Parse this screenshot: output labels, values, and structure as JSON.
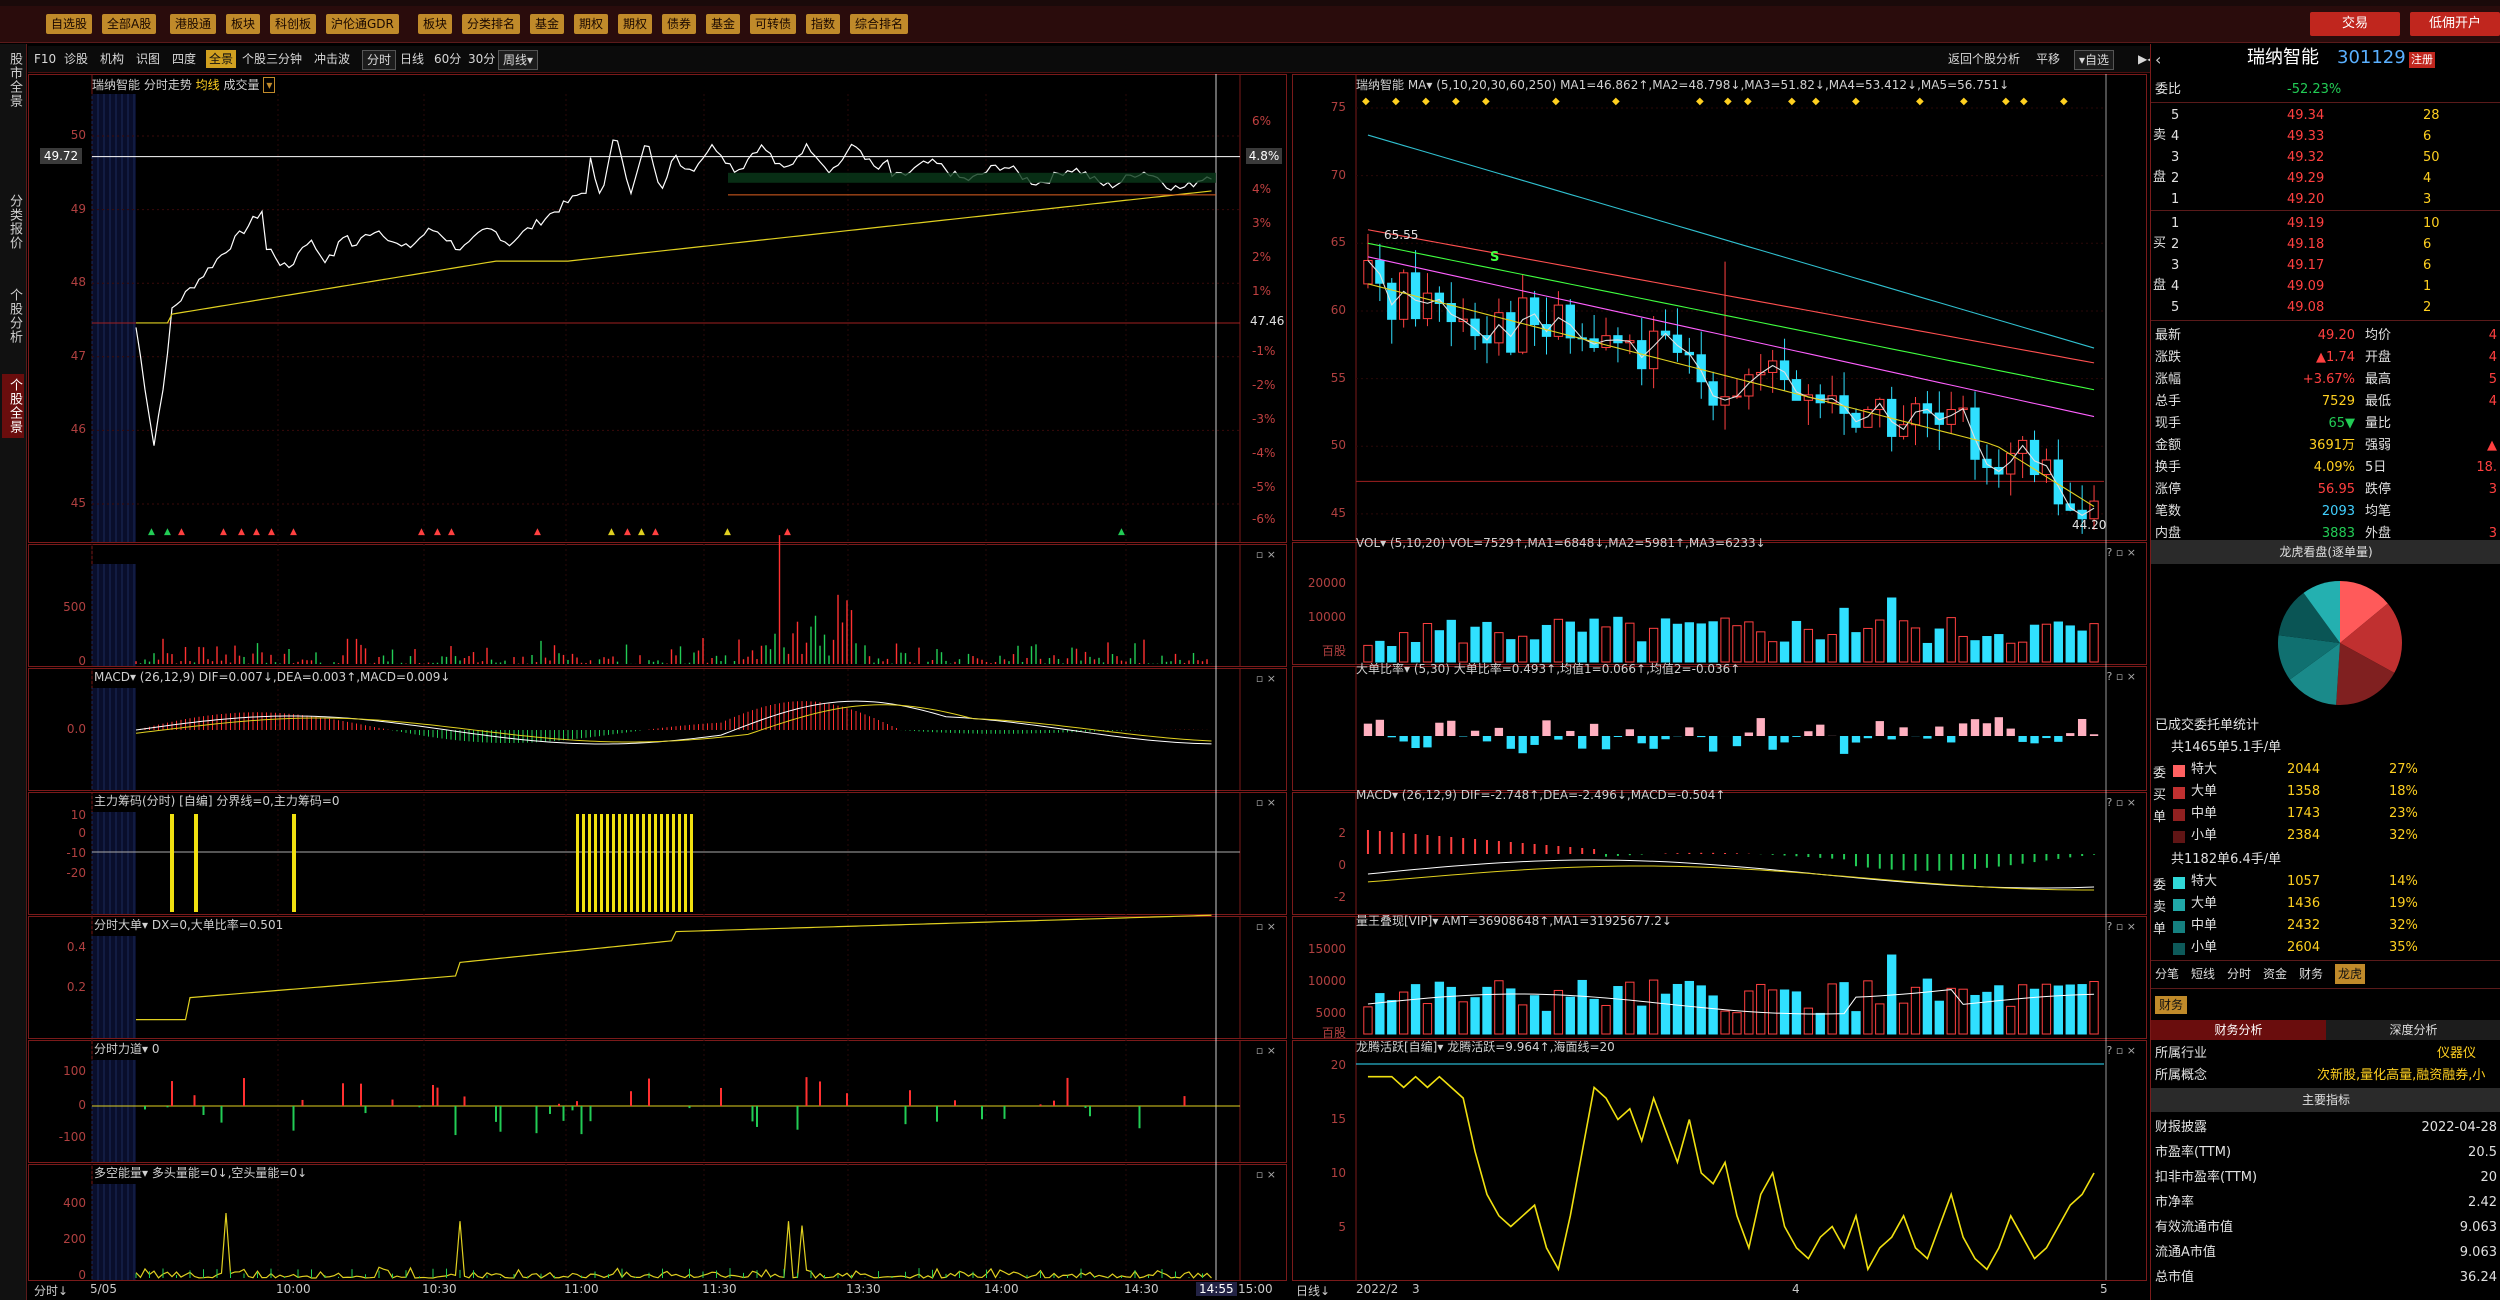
{
  "toolbar": {
    "buttons": [
      "自选股",
      "全部A股",
      "港股通",
      "板块",
      "科创板",
      "沪伦通GDR",
      "板块",
      "分类排名",
      "基金",
      "期权",
      "期权",
      "债券",
      "基金",
      "可转债",
      "指数",
      "综合排名"
    ],
    "right_buttons": [
      "交易",
      "低佣开户"
    ]
  },
  "leftnav": {
    "tabs": [
      "股市全景",
      "分类报价",
      "个股分析",
      "个股全景"
    ]
  },
  "subbar": {
    "items": [
      "F10",
      "诊股",
      "机构",
      "识图",
      "四度",
      "全景",
      "个股三分钟",
      "冲击波",
      "分时",
      "日线",
      "60分",
      "30分",
      "周线▾"
    ],
    "right_items": [
      "返回个股分析",
      "平移",
      "▾自选"
    ]
  },
  "intraday": {
    "title": "瑞纳智能  分时走势",
    "title_avg": "均线",
    "title_vol": "成交量",
    "price_ticks": [
      "50",
      "49",
      "48",
      "47",
      "46",
      "45"
    ],
    "pct_ticks": [
      "6%",
      "5%",
      "4%",
      "3%",
      "2%",
      "1%",
      "-1%",
      "-2%",
      "-3%",
      "-4%",
      "-5%",
      "-6%"
    ],
    "cursor_price": "49.72",
    "cursor_pct": "4.8%",
    "ref_price": "47.46",
    "vol_ticks": [
      "500",
      "0"
    ],
    "time_ticks": [
      "5/05",
      "10:00",
      "10:30",
      "11:00",
      "11:30",
      "13:30",
      "14:00",
      "14:30"
    ],
    "time_cursor": "14:55",
    "time_end": "15:00",
    "corner_label": "分时",
    "macd_title": "MACD▾ (26,12,9) DIF=0.007↓,DEA=0.003↑,MACD=0.009↓",
    "macd_ticks": [
      "0.0"
    ],
    "zl_title": "主力筹码(分时) [自编]  分界线=0,主力筹码=0",
    "zl_ticks": [
      "10",
      "0",
      "-10",
      "-20"
    ],
    "dd_title": "分时大单▾  DX=0,大单比率=0.501",
    "dd_ticks": [
      "0.4",
      "0.2"
    ],
    "ld_title": "分时力道▾  0",
    "ld_ticks": [
      "100",
      "0",
      "-100"
    ],
    "dk_title": "多空能量▾  多头量能=0↓,空头量能=0↓",
    "dk_ticks": [
      "400",
      "200",
      "0"
    ]
  },
  "kline": {
    "title": "瑞纳智能   MA▾ (5,10,20,30,60,250)  MA1=46.862↑,MA2=48.798↓,MA3=51.82↓,MA4=53.412↓,MA5=56.751↓",
    "price_ticks": [
      "75",
      "70",
      "65",
      "60",
      "55",
      "50",
      "45"
    ],
    "high_label": "65.55",
    "low_label": "44.20",
    "s_label": "S",
    "vol_title": "VOL▾ (5,10,20) VOL=7529↑,MA1=6848↓,MA2=5981↑,MA3=6233↓",
    "vol_ticks": [
      "20000",
      "10000",
      "百股"
    ],
    "ddb_title": "大单比率▾ (5,30) 大单比率=0.493↑,均值1=0.066↑,均值2=-0.036↑",
    "macd_title": "MACD▾ (26,12,9) DIF=-2.748↑,DEA=-2.496↓,MACD=-0.504↑",
    "macd_ticks": [
      "2",
      "0",
      "-2"
    ],
    "lz_title": "量王叠现[VIP]▾  AMT=36908648↑,MA1=31925677.2↓",
    "lz_ticks": [
      "15000",
      "10000",
      "5000",
      "百股"
    ],
    "lt_title": "龙腾活跃[自编]▾  龙腾活跃=9.964↑,海面线=20",
    "lt_ticks": [
      "20",
      "15",
      "10",
      "5"
    ],
    "date_ticks": [
      "2022/2",
      "3",
      "4",
      "5"
    ],
    "corner_label": "日线"
  },
  "sidebar": {
    "stock_name": "瑞纳智能",
    "stock_code": "301129",
    "badge": "注册",
    "webi_label": "委比",
    "webi_value": "-52.23%",
    "asks": [
      {
        "lv": "5",
        "price": "49.34",
        "vol": "28"
      },
      {
        "lv": "4",
        "price": "49.33",
        "vol": "6"
      },
      {
        "lv": "3",
        "price": "49.32",
        "vol": "50"
      },
      {
        "lv": "2",
        "price": "49.29",
        "vol": "4"
      },
      {
        "lv": "1",
        "price": "49.20",
        "vol": "3"
      }
    ],
    "bids": [
      {
        "lv": "1",
        "price": "49.19",
        "vol": "10"
      },
      {
        "lv": "2",
        "price": "49.18",
        "vol": "6"
      },
      {
        "lv": "3",
        "price": "49.17",
        "vol": "6"
      },
      {
        "lv": "4",
        "price": "49.09",
        "vol": "1"
      },
      {
        "lv": "5",
        "price": "49.08",
        "vol": "2"
      }
    ],
    "ask_side_label": [
      "卖",
      "盘"
    ],
    "bid_side_label": [
      "买",
      "盘"
    ],
    "quote": [
      {
        "l": "最新",
        "v": "49.20",
        "l2": "均价",
        "v2": "4"
      },
      {
        "l": "涨跌",
        "v": "▲1.74",
        "l2": "开盘",
        "v2": "4"
      },
      {
        "l": "涨幅",
        "v": "+3.67%",
        "l2": "最高",
        "v2": "5"
      },
      {
        "l": "总手",
        "v": "7529",
        "l2": "最低",
        "v2": "4"
      },
      {
        "l": "现手",
        "v": "65▼",
        "l2": "量比",
        "v2": ""
      },
      {
        "l": "金额",
        "v": "3691万",
        "l2": "强弱",
        "v2": "▲"
      },
      {
        "l": "换手",
        "v": "4.09%",
        "l2": "5日",
        "v2": "18."
      },
      {
        "l": "涨停",
        "v": "56.95",
        "l2": "跌停",
        "v2": "3"
      },
      {
        "l": "笔数",
        "v": "2093",
        "l2": "均笔",
        "v2": ""
      },
      {
        "l": "内盘",
        "v": "3883",
        "l2": "外盘",
        "v2": "3"
      }
    ],
    "pie_title": "龙虎看盘(逐单量)",
    "pie_slices": [
      {
        "value": 14,
        "color": "#ff5a5a"
      },
      {
        "value": 19,
        "color": "#c03030"
      },
      {
        "value": 18,
        "color": "#802020"
      },
      {
        "value": 14,
        "color": "#1a8a8a"
      },
      {
        "value": 12,
        "color": "#107070"
      },
      {
        "value": 13,
        "color": "#0a5555"
      },
      {
        "value": 10,
        "color": "#24b0b0"
      }
    ],
    "stats_title": "已成交委托单统计",
    "buy_group": "共1465单5.1手/单",
    "sell_group": "共1182单6.4手/单",
    "buy_side_label": [
      "委",
      "买",
      "单"
    ],
    "sell_side_label": [
      "委",
      "卖",
      "单"
    ],
    "buy_rows": [
      {
        "name": "特大",
        "vol": "2044",
        "pct": "27%",
        "color": "#ff6060"
      },
      {
        "name": "大单",
        "vol": "1358",
        "pct": "18%",
        "color": "#c03030"
      },
      {
        "name": "中单",
        "vol": "1743",
        "pct": "23%",
        "color": "#902020"
      },
      {
        "name": "小单",
        "vol": "2384",
        "pct": "32%",
        "color": "#601515"
      }
    ],
    "sell_rows": [
      {
        "name": "特大",
        "vol": "1057",
        "pct": "14%",
        "color": "#30d8d8"
      },
      {
        "name": "大单",
        "vol": "1436",
        "pct": "19%",
        "color": "#20a8a8"
      },
      {
        "name": "中单",
        "vol": "2432",
        "pct": "32%",
        "color": "#158080"
      },
      {
        "name": "小单",
        "vol": "2604",
        "pct": "35%",
        "color": "#0d5a5a"
      }
    ],
    "tabs": [
      "分笔",
      "短线",
      "分时",
      "资金",
      "财务",
      "龙虎"
    ],
    "fin_tab": "财务",
    "fin_subtabs": [
      "财务分析",
      "深度分析"
    ],
    "industry_label": "所属行业",
    "industry_value": "仪器仪",
    "concept_label": "所属概念",
    "concept_value": "次新股,量化高量,融资融券,小",
    "indicator_title": "主要指标",
    "fin_rows": [
      {
        "l": "财报披露",
        "v": "2022-04-28"
      },
      {
        "l": "市盈率(TTM)",
        "v": "20.5"
      },
      {
        "l": "扣非市盈率(TTM)",
        "v": "20"
      },
      {
        "l": "市净率",
        "v": "2.42"
      },
      {
        "l": "有效流通市值",
        "v": "9.063"
      },
      {
        "l": "流通A市值",
        "v": "9.063"
      },
      {
        "l": "总市值",
        "v": "36.24"
      }
    ]
  }
}
